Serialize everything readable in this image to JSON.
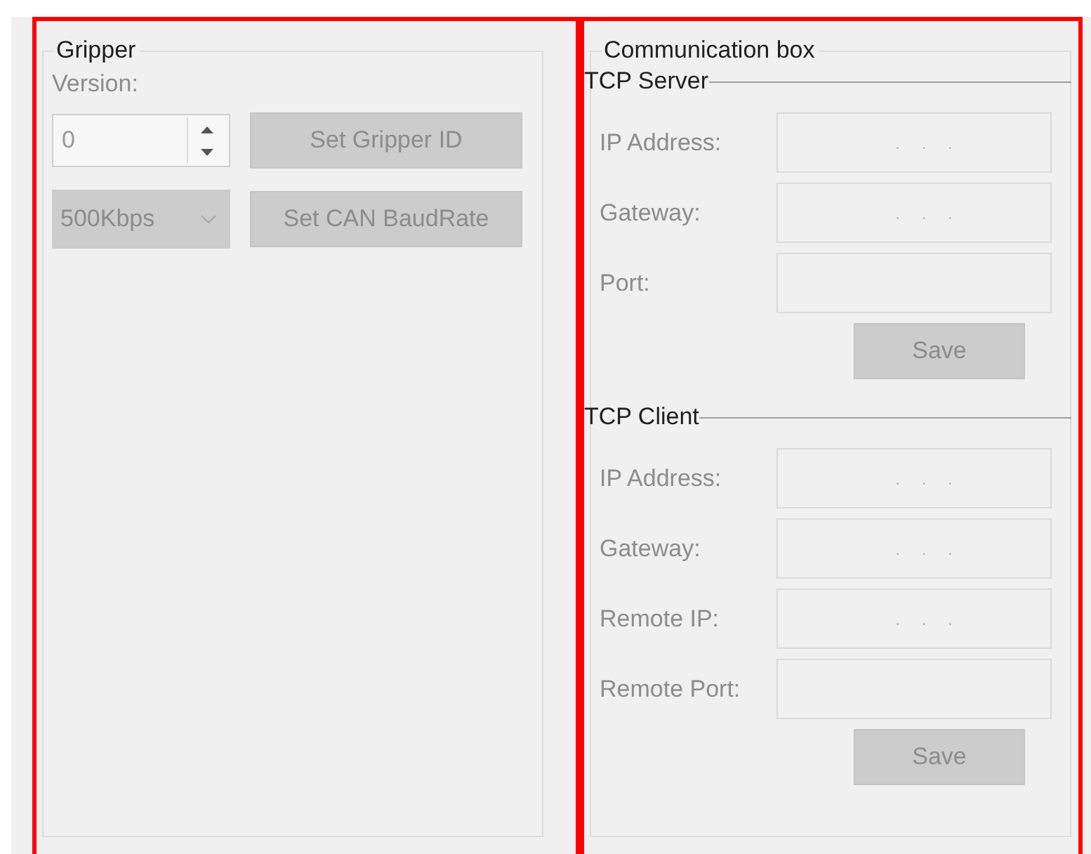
{
  "gripper": {
    "title": "Gripper",
    "disabled": true,
    "version_label": "Version:",
    "version_value": "0",
    "set_id_button": "Set Gripper ID",
    "baud_rate": "500Kbps",
    "set_baud_button": "Set CAN BaudRate"
  },
  "communication": {
    "title": "Communication box",
    "sections": [
      {
        "title": "TCP Server",
        "disabled": true,
        "fields": [
          {
            "label": "IP Address:",
            "value": ". . ."
          },
          {
            "label": "Gateway:",
            "value": ". . ."
          },
          {
            "label": "Port:"
          }
        ],
        "button": "Save"
      },
      {
        "title": "TCP Client",
        "disabled": true,
        "fields": [
          {
            "label": "IP Address:",
            "value": ". . ."
          },
          {
            "label": "Gateway:",
            "value": ". . ."
          },
          {
            "label": "Remote IP:",
            "value": ". . ."
          },
          {
            "label": "Remote Port:"
          }
        ],
        "button": "Save"
      }
    ]
  },
  "highlight_frames": [
    {
      "kind": "outline"
    },
    {
      "kind": "outline"
    }
  ]
}
